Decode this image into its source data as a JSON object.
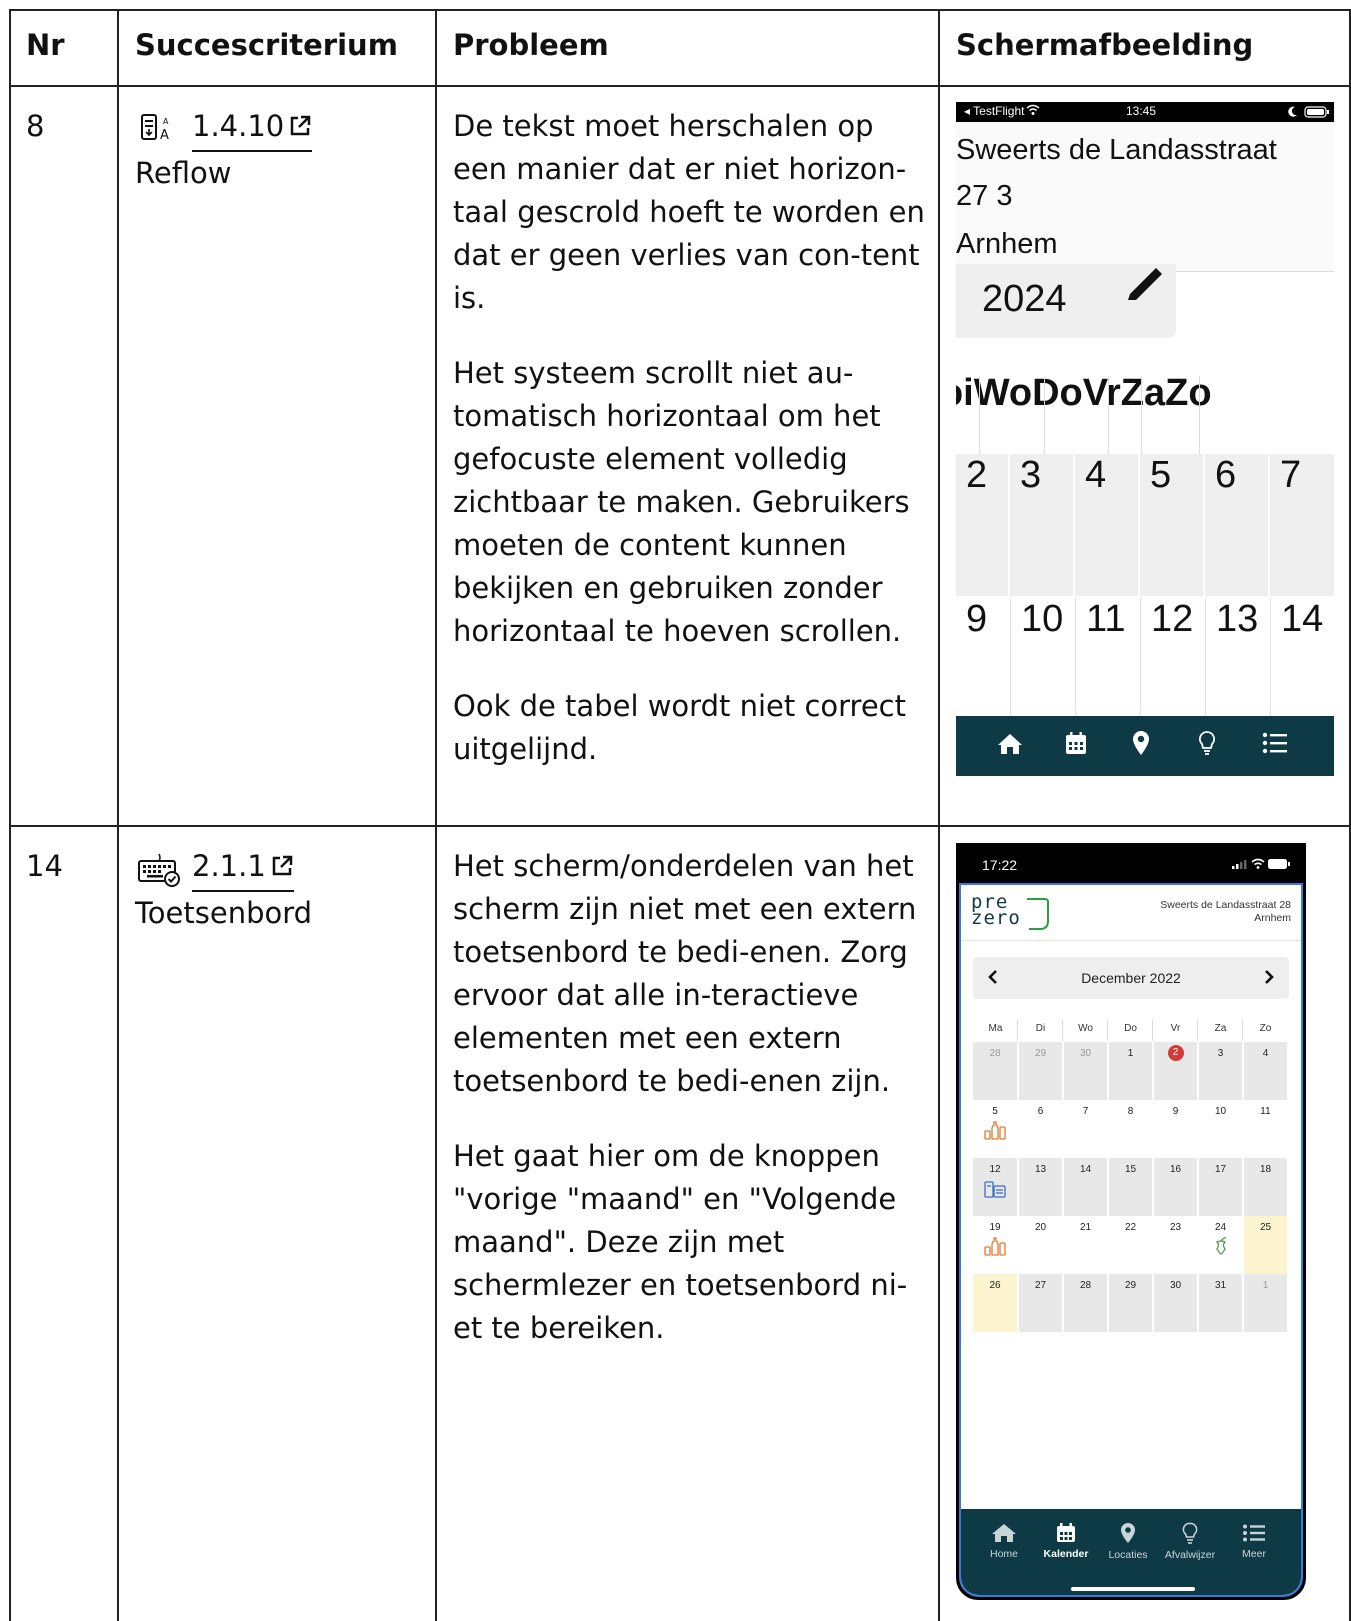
{
  "table": {
    "headers": [
      "Nr",
      "Succescriterium",
      "Probleem",
      "Schermafbeelding"
    ],
    "rows": [
      {
        "nr": "8",
        "criterion_code": "1.4.10",
        "criterion_name": "Reflow",
        "criterion_icon": "reflow-icon",
        "problem": [
          "De tekst moet herschalen op een manier dat er niet horizon-taal gescrold hoeft te worden en dat er geen verlies van con-tent is.",
          "Het systeem scrollt niet au-tomatisch horizontaal om het gefocuste element volledig zichtbaar te maken. Gebruikers moeten de content kunnen bekijken en gebruiken zonder horizontaal te hoeven scrollen.",
          "Ook de tabel wordt niet correct uitgelijnd."
        ]
      },
      {
        "nr": "14",
        "criterion_code": "2.1.1",
        "criterion_name": "Toetsenbord",
        "criterion_icon": "keyboard-icon",
        "problem": [
          "Het scherm/onderdelen van het scherm zijn niet met een extern toetsenbord te bedi-enen. Zorg ervoor dat alle in-teractieve elementen met een extern toetsenbord te bedi-enen zijn.",
          "Het gaat hier om de knoppen \"vorige \"maand\" en \"Volgende maand\". Deze zijn met schermlezer en toetsenbord ni-et te bereiken."
        ]
      }
    ]
  },
  "shot1": {
    "status_left": "◂ TestFlight",
    "status_time": "13:45",
    "address_line1": "Sweerts de Landasstraat",
    "address_line2": "27 3",
    "address_line3": "Arnhem",
    "year": "2024",
    "weekdays_row": "ɔiWoDoVrZaZo",
    "week1": [
      "2",
      "3",
      "4",
      "5",
      "6",
      "7"
    ],
    "week2": [
      "9",
      "10",
      "11",
      "12",
      "13",
      "14"
    ],
    "nav_icons": [
      "home-icon",
      "calendar-icon",
      "location-icon",
      "bulb-icon",
      "list-icon"
    ],
    "nav_color": "#0e3a45"
  },
  "shot2": {
    "status_time": "17:22",
    "logo_top": "pre",
    "logo_bottom": "zero",
    "address_line1": "Sweerts de Landasstraat 28",
    "address_line2": "Arnhem",
    "month_label": "December 2022",
    "weekdays": [
      "Ma",
      "Di",
      "Wo",
      "Do",
      "Vr",
      "Za",
      "Zo"
    ],
    "weeks": [
      [
        "28",
        "29",
        "30",
        "1",
        "2",
        "3",
        "4"
      ],
      [
        "5",
        "6",
        "7",
        "8",
        "9",
        "10",
        "11"
      ],
      [
        "12",
        "13",
        "14",
        "15",
        "16",
        "17",
        "18"
      ],
      [
        "19",
        "20",
        "21",
        "22",
        "23",
        "24",
        "25"
      ],
      [
        "26",
        "27",
        "28",
        "29",
        "30",
        "31",
        "1"
      ]
    ],
    "nav": [
      "Home",
      "Kalender",
      "Locaties",
      "Afvalwijzer",
      "Meer"
    ],
    "active_nav": "Kalender",
    "accent_today": "#d33b3b",
    "holiday_color": "#fbf4cf",
    "logo_green": "#2e9e3e"
  }
}
